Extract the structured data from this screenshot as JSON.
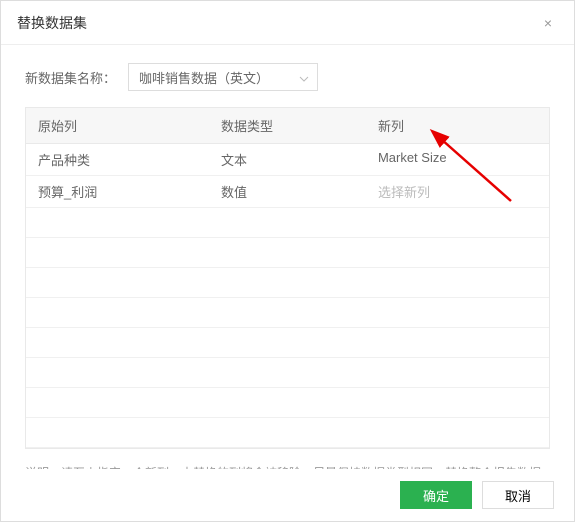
{
  "dialog": {
    "title": "替换数据集",
    "close_icon": "×"
  },
  "form": {
    "dataset_label": "新数据集名称：",
    "dataset_value": "咖啡销售数据（英文）"
  },
  "table": {
    "headers": {
      "original_col": "原始列",
      "data_type": "数据类型",
      "new_col": "新列"
    },
    "rows": [
      {
        "original": "产品种类",
        "type": "文本",
        "new_col": "Market Size",
        "is_placeholder": false
      },
      {
        "original": "预算_利润",
        "type": "数值",
        "new_col": "选择新列",
        "is_placeholder": true
      }
    ]
  },
  "hint": "说明：请至少指定一个新列，未替换的列将会被移除，尽量保持数据类型相同，替换整个报告数据集请到顶部\"替换数据集\"。",
  "footer": {
    "ok": "确定",
    "cancel": "取消"
  }
}
